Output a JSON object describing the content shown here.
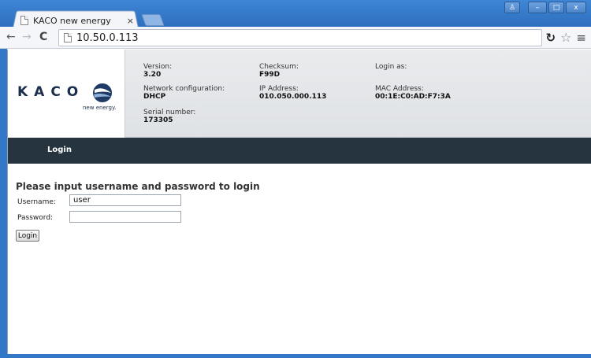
{
  "browser": {
    "tab_title": "KACO new energy",
    "tab_close": "×",
    "url": "10.50.0.113",
    "window_buttons": {
      "user": "♙",
      "minimize": "–",
      "maximize": "□",
      "close": "x"
    },
    "nav": {
      "back": "←",
      "forward": "→",
      "reload": "C"
    },
    "toolbar_icons": {
      "extension": "↻",
      "star": "☆",
      "menu": "≡"
    },
    "accent": "#3378c8"
  },
  "header": {
    "logo": {
      "text": "KACO",
      "tagline": "new energy."
    },
    "info": {
      "version": {
        "label": "Version:",
        "value": "3.20"
      },
      "checksum": {
        "label": "Checksum:",
        "value": "F99D"
      },
      "login_as": {
        "label": "Login as:",
        "value": ""
      },
      "network": {
        "label": "Network configuration:",
        "value": "DHCP"
      },
      "ip": {
        "label": "IP Address:",
        "value": "010.050.000.113"
      },
      "mac": {
        "label": "MAC Address:",
        "value": "00:1E:C0:AD:F7:3A"
      },
      "serial": {
        "label": "Serial number:",
        "value": "173305"
      }
    }
  },
  "navbar": {
    "login_label": "Login",
    "color": "#26343f"
  },
  "login_form": {
    "heading": "Please input username and password to login",
    "username_label": "Username:",
    "username_value": "user",
    "password_label": "Password:",
    "password_value": "",
    "button_label": "Login"
  }
}
